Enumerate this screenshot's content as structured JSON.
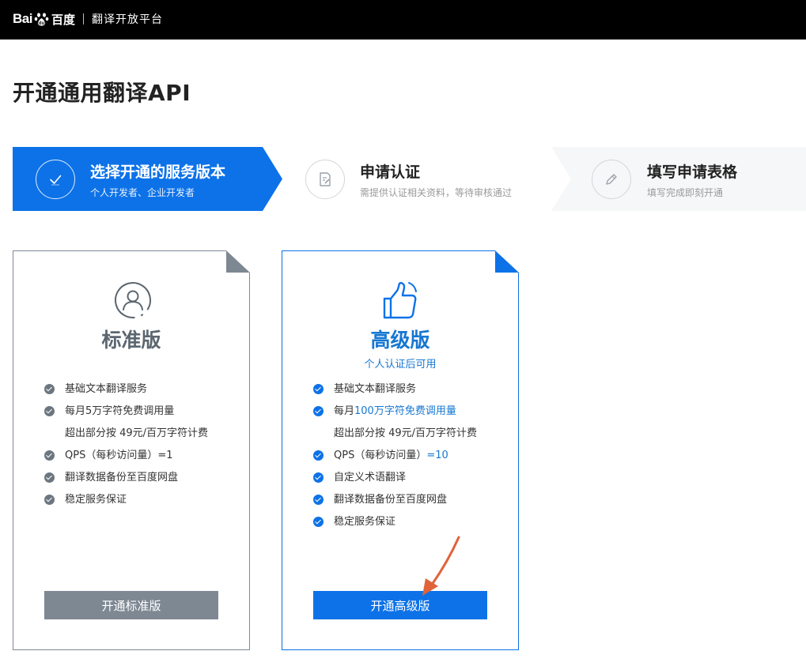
{
  "header": {
    "logo_bai": "Bai",
    "logo_du": "百度",
    "platform": "翻译开放平台"
  },
  "page": {
    "title": "开通通用翻译API"
  },
  "steps": [
    {
      "title": "选择开通的服务版本",
      "desc": "个人开发者、企业开发者",
      "icon": "check-circle-icon",
      "active": true
    },
    {
      "title": "申请认证",
      "desc": "需提供认证相关资料，等待审核通过",
      "icon": "document-edit-icon",
      "active": false
    },
    {
      "title": "填写申请表格",
      "desc": "填写完成即刻开通",
      "icon": "pencil-icon",
      "active": false
    }
  ],
  "cards": {
    "standard": {
      "title": "标准版",
      "icon": "user-icon",
      "features": {
        "f1": "基础文本翻译服务",
        "f2": "每月5万字符免费调用量",
        "f2b": "超出部分按 49元/百万字符计费",
        "f3": "QPS（每秒访问量）=1",
        "f4": "翻译数据备份至百度网盘",
        "f5": "稳定服务保证"
      },
      "button": "开通标准版"
    },
    "advanced": {
      "title": "高级版",
      "subtitle": "个人认证后可用",
      "icon": "thumbs-up-icon",
      "features": {
        "f1": "基础文本翻译服务",
        "f2_prefix": "每月",
        "f2_highlight": "100万字符免费调用量",
        "f2b": "超出部分按 49元/百万字符计费",
        "f3_prefix": "QPS（每秒访问量）",
        "f3_highlight": "=10",
        "f4": "自定义术语翻译",
        "f5": "翻译数据备份至百度网盘",
        "f6": "稳定服务保证"
      },
      "button": "开通高级版"
    }
  },
  "colors": {
    "primary": "#0d72e8",
    "standard_button": "#7e8893",
    "standard_title": "#5b6670",
    "advanced_title": "#1677d2",
    "check_gray": "#6b7680",
    "annotation_arrow": "#e0633a"
  }
}
